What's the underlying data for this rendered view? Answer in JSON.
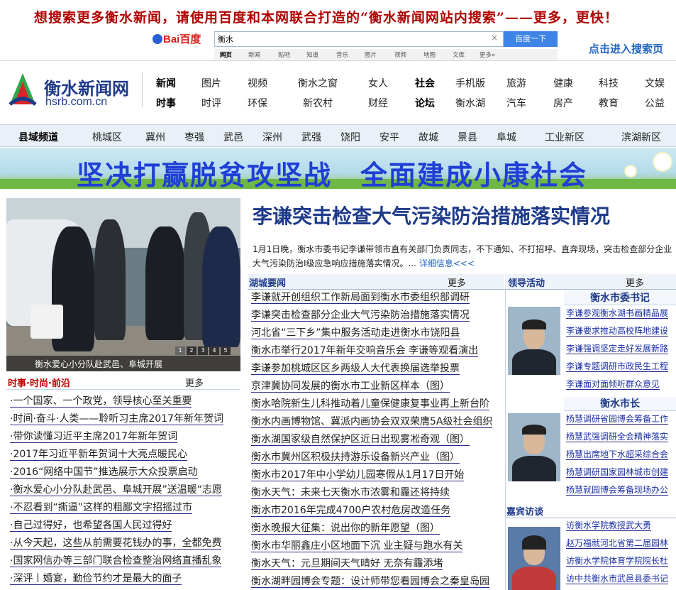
{
  "topbar": {
    "slogan": "想搜索更多衡水新闻，请使用百度和本网联合打造的“衡水新闻网站内搜索”——更多，更快！",
    "baidu_logo": "Bai百度",
    "search_value": "衡水",
    "search_clear": "×",
    "search_button": "百度一下",
    "tabs": [
      "网页",
      "新闻",
      "贴吧",
      "知道",
      "音乐",
      "图片",
      "视频",
      "地图",
      "文库",
      "更多»"
    ],
    "search_page_link": "点击进入搜索页"
  },
  "header": {
    "logo_text": "衡水新闻网",
    "logo_url": "hsrb.com.cn",
    "nav_row1": [
      "新闻",
      "图片",
      "视频",
      "衡水之窗",
      "女人",
      "社会",
      "手机版",
      "旅游",
      "健康",
      "科技",
      "文娱"
    ],
    "nav_row2": [
      "时事",
      "时评",
      "环保",
      "新农村",
      "财经",
      "论坛",
      "衡水湖",
      "汽车",
      "房产",
      "教育",
      "公益"
    ]
  },
  "county": {
    "title": "县域频道",
    "items": [
      "桃城区",
      "冀州",
      "枣强",
      "武邑",
      "深州",
      "武强",
      "饶阳",
      "安平",
      "故城",
      "景县",
      "阜城",
      "工业新区",
      "滨湖新区"
    ]
  },
  "banner": {
    "text": "坚决打赢脱贫攻坚战　全面建成小康社会"
  },
  "photo": {
    "caption": "衡水爱心小分队赴武邑、阜城开展",
    "pager": [
      "1",
      "2",
      "3",
      "4",
      "5"
    ]
  },
  "left_list": {
    "title": "时事·时尚·前沿",
    "more": "更多",
    "items": [
      "·一个国家、一个政党，领导核心至关重要",
      "·时间·奋斗·人类——聆听习主席2017年新年贺词",
      "·带你读懂习近平主席2017年新年贺词",
      "·2017年习近平新年贺词十大亮点暖民心",
      "·2016“网络中国节”推选展示大众投票启动",
      "·衡水爱心小分队赴武邑、阜城开展”送温暖“志愿",
      "·不忍看到“撕逼”这样的粗鄙文字招摇过市",
      "·自己过得好，也希望各国人民过得好",
      "·从今天起，这些从前需要花钱办的事，全都免费",
      "·国家网信办等三部门联合检查整治网络直播乱象",
      "·深评丨婚宴，勤俭节约才是最大的面子"
    ]
  },
  "headline": {
    "title": "李谦突击检查大气污染防治措施落实情况",
    "summary": "1月1日晚，衡水市委书记李谦带领市直有关部门负责同志，不下通知、不打招呼、直奔现场，突击检查部分企业大气污染防治Ⅰ级应急响应措施落实情况。...",
    "more_link": "详细信息<<<"
  },
  "mid_list": {
    "title": "湖城要闻",
    "more": "更多",
    "items": [
      "李谦就开创组织工作新局面到衡水市委组织部调研",
      "李谦突击检查部分企业大气污染防治措施落实情况",
      "河北省“三下乡”集中服务活动走进衡水市饶阳县",
      "衡水市举行2017年新年交响音乐会 李谦等观看演出",
      "李谦参加桃城区区乡两级人大代表换届选举投票",
      "京津冀协同发展的衡水市工业新区样本（图）",
      "衡水哈院新生儿科推动着儿童保健康复事业再上新台阶",
      "衡水内画博物馆、冀派内画协会双双荣膺5A级社会组织",
      "衡水湖国家级自然保护区近日出现雾凇奇观（图）",
      "衡水市冀州区积极扶持游乐设备新兴产业（图）",
      "衡水市2017年中小学幼儿园寒假从1月17日开始",
      "衡水天气：未来七天衡水市浓雾和霾还将持续",
      "衡水市2016年完成4700户农村危房改造任务",
      "衡水晚报大征集：说出你的新年愿望（图）",
      "衡水市华丽鑫庄小区地面下沉 业主疑与跑水有关",
      "衡水天气：元旦期间天气晴好 无奈有霾添堵",
      "衡水湖畔园博会专题：设计师带您看园博会之秦皇岛园"
    ]
  },
  "right": {
    "title": "领导活动",
    "more": "更多",
    "secretary_title": "衡水市委书记",
    "secretary_items": [
      "李谦参观衡水湖书画精品展",
      "李谦要求推动高校阵地建设",
      "李谦强调坚定走好发展新路",
      "李谦专题调研市政民生工程",
      "李谦面对面倾听群众意见"
    ],
    "mayor_title": "衡水市长",
    "mayor_items": [
      "杨慧调研省园博会筹备工作",
      "杨慧武强调研全会精神落实",
      "杨慧出席地下水超采综合会",
      "杨慧调研国家园林城市创建",
      "杨慧就园博会筹备现场办公"
    ],
    "guest_title": "嘉宾访谈",
    "guest_items": [
      "访衡水学院教授武大勇",
      "赵万福就河北省第二届园林",
      "访衡水学院体育学院院长杜",
      "访中共衡水市武邑县委书记"
    ]
  }
}
